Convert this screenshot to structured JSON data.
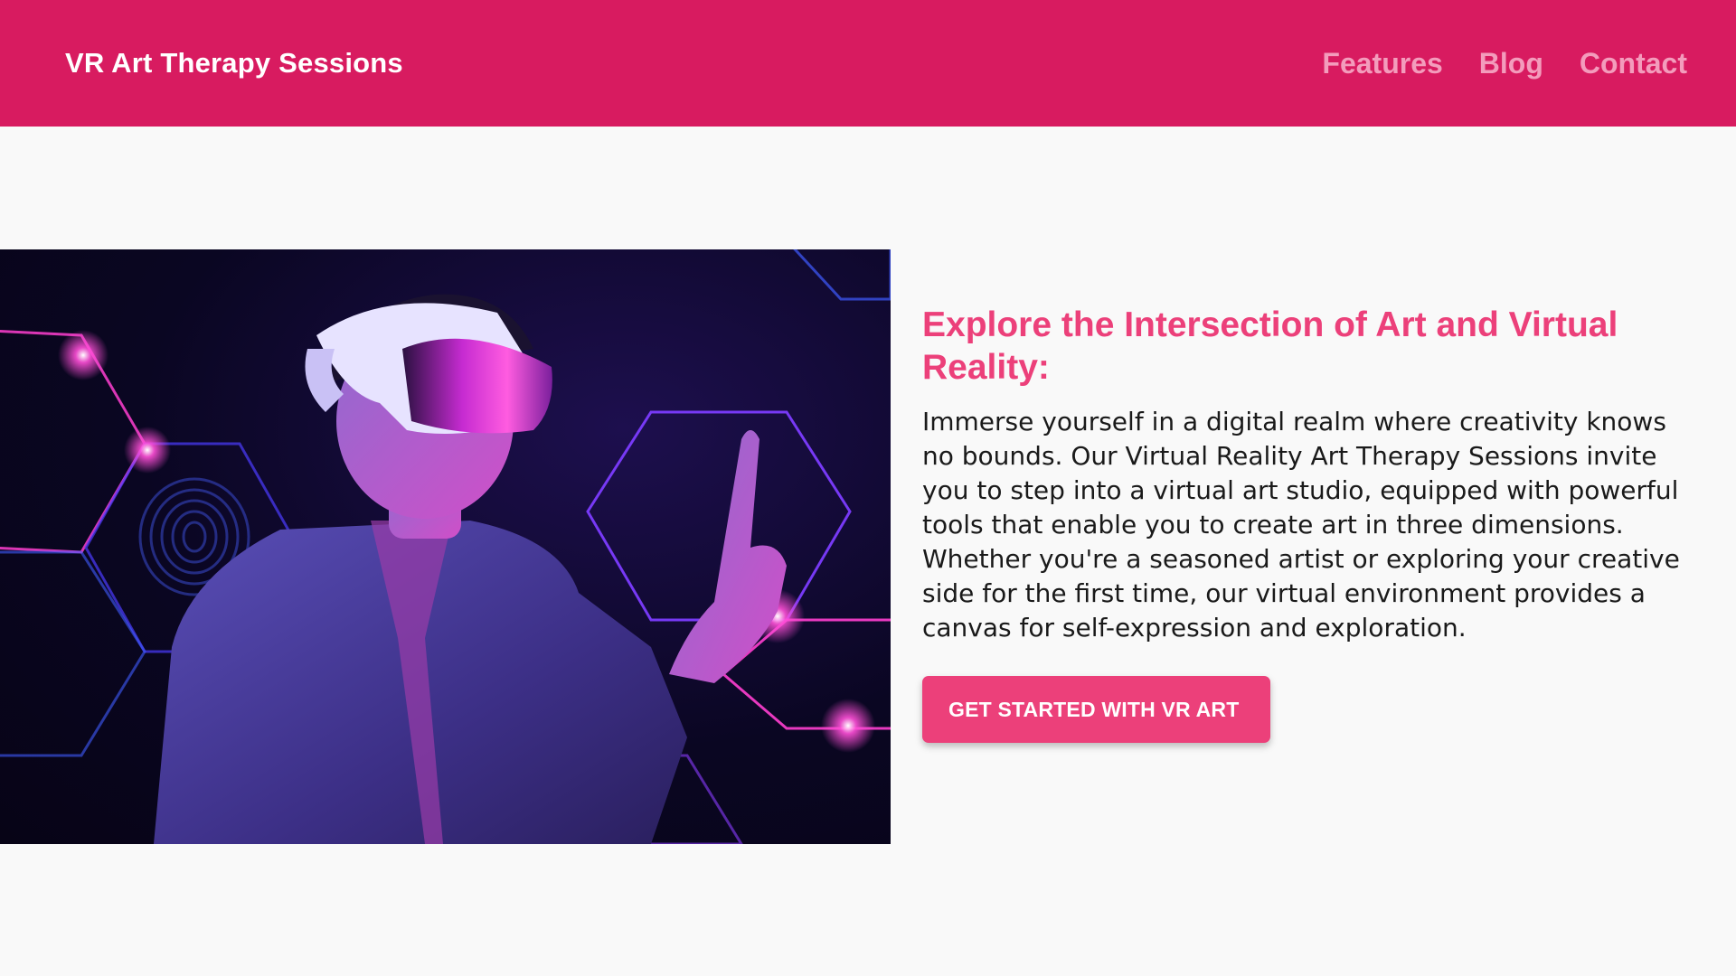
{
  "header": {
    "brand": "VR Art Therapy Sessions",
    "nav": [
      {
        "label": "Features"
      },
      {
        "label": "Blog"
      },
      {
        "label": "Contact"
      }
    ]
  },
  "hero": {
    "image_icon": "vr-headset-person-illustration",
    "title": "Explore the Intersection of Art and Virtual Reality:",
    "body": "Immerse yourself in a digital realm where creativity knows no bounds. Our Virtual Reality Art Therapy Sessions invite you to step into a virtual art studio, equipped with powerful tools that enable you to create art in three dimensions. Whether you're a seasoned artist or exploring your creative side for the first time, our virtual environment provides a canvas for self-expression and exploration.",
    "cta_label": "GET STARTED WITH VR ART"
  },
  "colors": {
    "header_bg": "#d81b60",
    "accent": "#ec407a",
    "nav_link": "#f39cbc",
    "page_bg": "#f9f9f9"
  }
}
